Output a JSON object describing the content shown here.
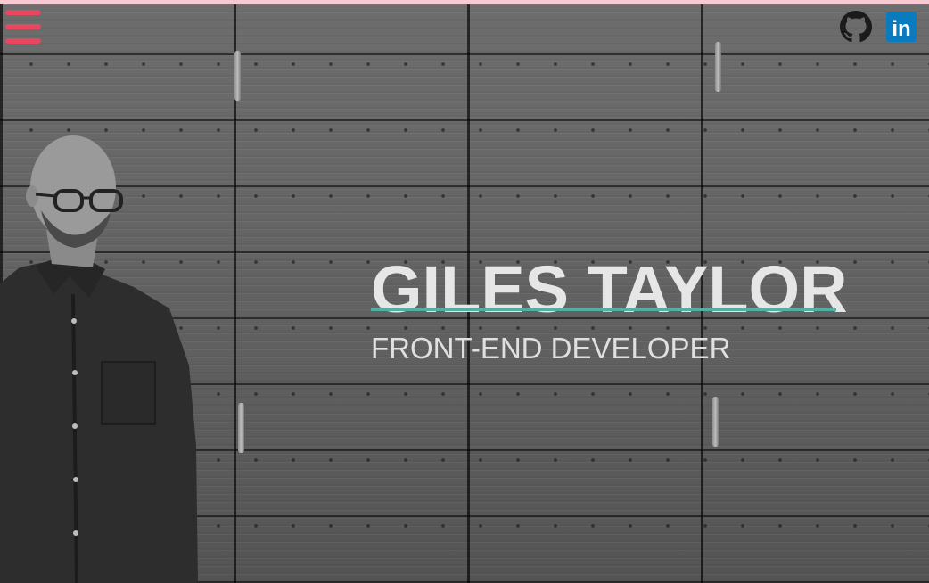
{
  "header": {
    "menu_icon": "hamburger-menu-icon",
    "accent_color": "#e8475f",
    "social": [
      {
        "name": "GitHub",
        "icon": "github-icon"
      },
      {
        "name": "LinkedIn",
        "icon": "linkedin-icon",
        "color": "#0a7bbf",
        "label": "in"
      }
    ]
  },
  "hero": {
    "name": "GILES TAYLOR",
    "role": "FRONT-END DEVELOPER",
    "rule_color": "#4fb0a6"
  },
  "background": {
    "description_icon": "wood-wall-background"
  }
}
